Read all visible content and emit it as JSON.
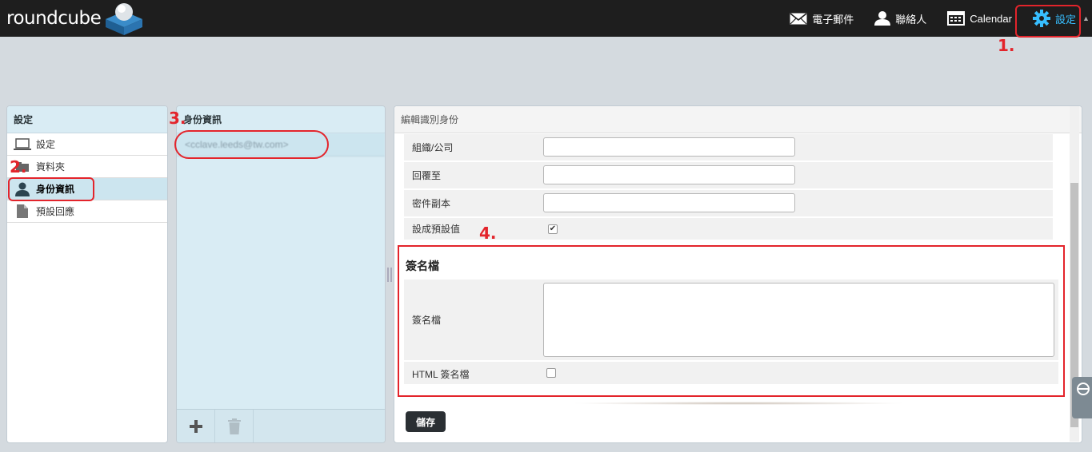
{
  "app": {
    "logo_text": "roundcube"
  },
  "nav": {
    "mail": "電子郵件",
    "contacts": "聯絡人",
    "calendar": "Calendar",
    "settings": "設定"
  },
  "annotations": {
    "n1": "1.",
    "n2": "2.",
    "n3": "3.",
    "n4": "4."
  },
  "settings_panel": {
    "title": "設定",
    "items": [
      {
        "label": "設定",
        "icon": "laptop-icon"
      },
      {
        "label": "資料夾",
        "icon": "folder-icon"
      },
      {
        "label": "身份資訊",
        "icon": "user-icon",
        "selected": true
      },
      {
        "label": "預設回應",
        "icon": "document-icon"
      }
    ]
  },
  "identities_panel": {
    "title": "身份資訊",
    "items": [
      "<cclave.leeds@tw.com>"
    ]
  },
  "edit_panel": {
    "title": "編輯識別身份",
    "fields": {
      "organization": {
        "label": "組織/公司",
        "value": ""
      },
      "reply_to": {
        "label": "回覆至",
        "value": ""
      },
      "bcc": {
        "label": "密件副本",
        "value": ""
      },
      "default": {
        "label": "設成預設值",
        "checked": true
      }
    },
    "signature_section": {
      "title": "簽名檔",
      "signature_label": "簽名檔",
      "signature_value": "",
      "html_label": "HTML 簽名檔",
      "html_checked": false
    },
    "save_label": "儲存"
  },
  "colors": {
    "accent": "#37beff",
    "annotation": "#e3242b",
    "topbar": "#1e1e1e"
  }
}
